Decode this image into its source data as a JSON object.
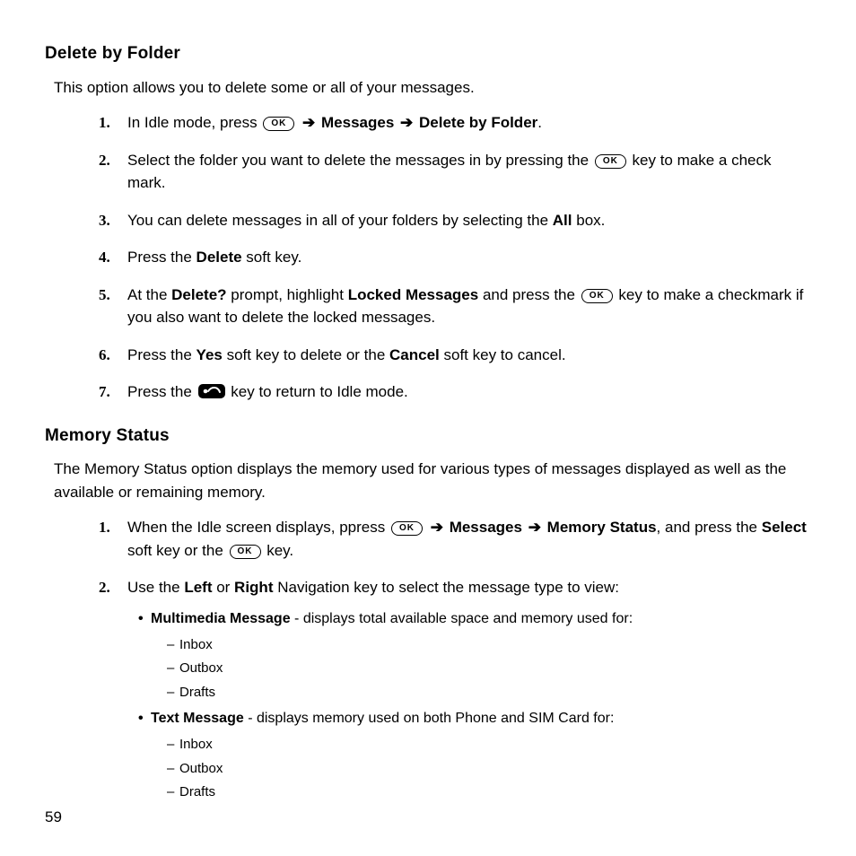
{
  "page_number": "59",
  "keys": {
    "ok": "OK"
  },
  "section1": {
    "heading": "Delete by Folder",
    "intro": "This option allows you to delete some or all of your messages.",
    "steps": {
      "s1": {
        "num": "1.",
        "a": "In Idle mode, press ",
        "b": " Messages ",
        "c": " Delete by Folder",
        "d": "."
      },
      "s2": {
        "num": "2.",
        "a": "Select the folder you want to delete the messages in by pressing the ",
        "b": " key to make a check mark."
      },
      "s3": {
        "num": "3.",
        "a": "You can delete messages in all of your folders by selecting the ",
        "b": "All",
        "c": " box."
      },
      "s4": {
        "num": "4.",
        "a": "Press the ",
        "b": "Delete",
        "c": " soft key."
      },
      "s5": {
        "num": "5.",
        "a": "At the ",
        "b": "Delete?",
        "c": " prompt, highlight ",
        "d": "Locked Messages",
        "e": " and press the ",
        "f": " key to make a checkmark if you also want to delete the locked messages."
      },
      "s6": {
        "num": "6.",
        "a": "Press the ",
        "b": "Yes",
        "c": " soft key to delete or the ",
        "d": "Cancel",
        "e": " soft key to cancel."
      },
      "s7": {
        "num": "7.",
        "a": "Press the ",
        "b": " key to return to Idle mode."
      }
    }
  },
  "section2": {
    "heading": "Memory Status",
    "intro": "The Memory Status option displays the memory used for various types of messages displayed as well as the available or remaining memory.",
    "steps": {
      "s1": {
        "num": "1.",
        "a": "When the Idle screen displays, ppress ",
        "b": " Messages ",
        "c": " Memory Status",
        "d": ", and press the ",
        "e": "Select",
        "f": " soft key or the ",
        "g": " key."
      },
      "s2": {
        "num": "2.",
        "a": "Use the ",
        "b": "Left",
        "c": " or ",
        "d": "Right",
        "e": " Navigation key to select the message type to view:",
        "bullets": {
          "b1": {
            "a": "Multimedia Message",
            "b": " - displays total available space and memory used for:",
            "items": {
              "i1": "Inbox",
              "i2": "Outbox",
              "i3": "Drafts"
            }
          },
          "b2": {
            "a": "Text Message",
            "b": " - displays memory used on both Phone and SIM Card for:",
            "items": {
              "i1": "Inbox",
              "i2": "Outbox",
              "i3": "Drafts"
            }
          }
        }
      }
    }
  }
}
